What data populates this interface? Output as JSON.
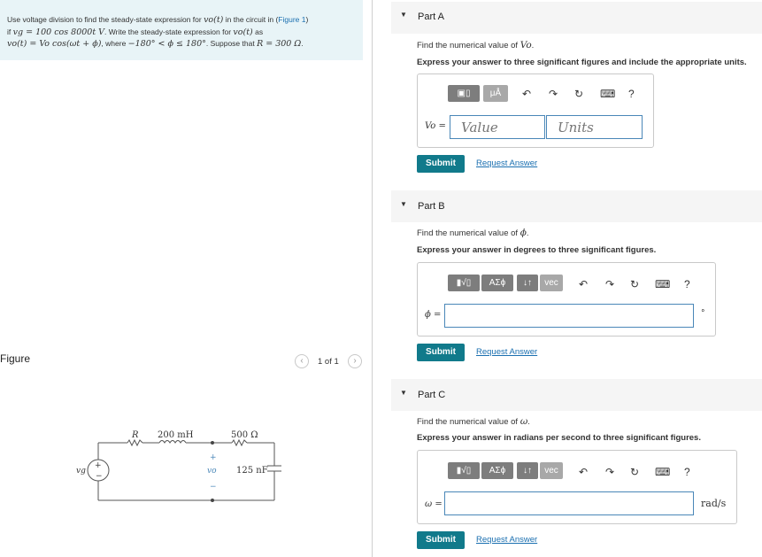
{
  "problem": {
    "line1_text": "Use voltage division to find the steady-state expression for ",
    "vo_t": "vo(t)",
    "line1_mid": " in the circuit in (",
    "figure_link": "Figure 1",
    "line1_end": ")",
    "line2_if": "if ",
    "vg_eq": "vg = 100 cos 8000t V",
    "line2_text": ". Write the steady-state expression for ",
    "line2_vo": "vo(t)",
    "line2_as": " as",
    "line3_eq": "vo(t) = Vo cos(ωt + ϕ)",
    "line3_where": ", where ",
    "line3_range": "−180° < ϕ ≤ 180°",
    "line3_suppose": ". Suppose that ",
    "line3_R": "R = 300 Ω",
    "line3_end": "."
  },
  "figure": {
    "label": "Figure",
    "pager_text": "1 of 1",
    "prev_glyph": "‹",
    "next_glyph": "›",
    "circuit": {
      "R_label": "R",
      "L_label": "200 mH",
      "R2_label": "500 Ω",
      "C_label": "125 nF",
      "vg_label": "vg",
      "vo_label": "vo",
      "plus": "+",
      "minus": "−"
    }
  },
  "parts": [
    {
      "title": "Part A",
      "prompt_text": "Find the numerical value of ",
      "prompt_var": "Vo",
      "prompt_end": ".",
      "instruction": "Express your answer to three significant figures and include the appropriate units.",
      "var_label": "Vo =",
      "value_placeholder": "Value",
      "units_placeholder": "Units",
      "tool_label_1": "▣▯",
      "tool_label_2": "μÅ",
      "submit": "Submit",
      "request": "Request Answer"
    },
    {
      "title": "Part B",
      "prompt_text": "Find the numerical value of ",
      "prompt_var": "ϕ",
      "prompt_end": ".",
      "instruction": "Express your answer in degrees to three significant figures.",
      "var_label": "ϕ =",
      "unit_suffix": "°",
      "tool_label_1": "▮√▯",
      "tool_label_2": "ΑΣϕ",
      "tool_label_3": "↓↑",
      "tool_label_4": "vec",
      "submit": "Submit",
      "request": "Request Answer"
    },
    {
      "title": "Part C",
      "prompt_text": "Find the numerical value of ",
      "prompt_var": "ω",
      "prompt_end": ".",
      "instruction": "Express your answer in radians per second to three significant figures.",
      "var_label": "ω =",
      "unit_suffix": "rad/s",
      "tool_label_1": "▮√▯",
      "tool_label_2": "ΑΣϕ",
      "tool_label_3": "↓↑",
      "tool_label_4": "vec",
      "submit": "Submit",
      "request": "Request Answer"
    }
  ],
  "toolbar": {
    "undo_glyph": "↶",
    "redo_glyph": "↷",
    "reset_glyph": "↻",
    "keyboard_glyph": "⌨",
    "help_glyph": "?"
  }
}
